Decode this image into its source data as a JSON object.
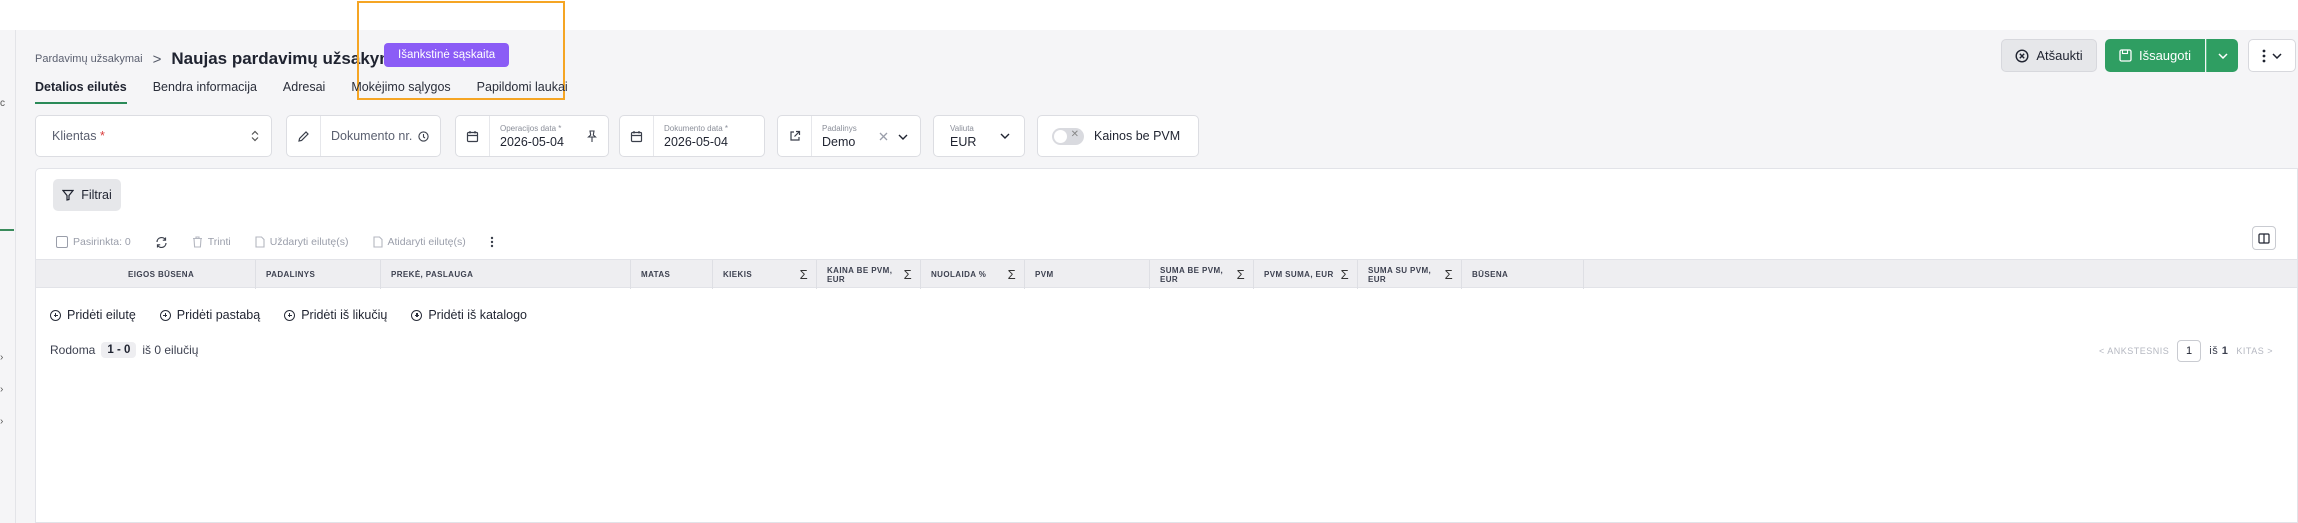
{
  "header": {
    "breadcrumb_parent": "Pardavimų užsakymai",
    "breadcrumb_sep": ">",
    "title": "Naujas pardavimų užsakymas",
    "badge": "Išankstinė sąskaita"
  },
  "tabs": [
    "Detalios eilutės",
    "Bendra informacija",
    "Adresai",
    "Mokėjimo sąlygos",
    "Papildomi laukai"
  ],
  "actions": {
    "cancel_label": "Atšaukti",
    "save_label": "Išsaugoti"
  },
  "fields": {
    "client_label": "Klientas",
    "client_required": "*",
    "doc_number_placeholder": "Dokumento nr.",
    "operation_date_label": "Operacijos data *",
    "operation_date_value": "2026-05-04",
    "document_date_label": "Dokumento data *",
    "document_date_value": "2026-05-04",
    "unit_label": "Padalinys",
    "unit_value": "Demo",
    "currency_label": "Valiuta",
    "currency_value": "EUR",
    "prices_without_vat": "Kainos be PVM"
  },
  "panel": {
    "filters_label": "Filtrai",
    "selected": "Pasirinkta: 0",
    "delete": "Trinti",
    "close_rows": "Uždaryti eilutę(s)",
    "open_rows": "Atidaryti eilutę(s)"
  },
  "table": {
    "columns": [
      {
        "label": "EIGOS BŪSENA",
        "sum": false
      },
      {
        "label": "PADALINYS",
        "sum": false
      },
      {
        "label": "PREKĖ, PASLAUGA",
        "sum": false
      },
      {
        "label": "MATAS",
        "sum": false
      },
      {
        "label": "KIEKIS",
        "sum": true
      },
      {
        "label": "KAINA BE PVM, EUR",
        "sum": true
      },
      {
        "label": "NUOLAIDA %",
        "sum": true
      },
      {
        "label": "PVM",
        "sum": false
      },
      {
        "label": "SUMA BE PVM, EUR",
        "sum": true
      },
      {
        "label": "PVM SUMA, EUR",
        "sum": true
      },
      {
        "label": "SUMA SU PVM, EUR",
        "sum": true
      },
      {
        "label": "BŪSENA",
        "sum": false
      }
    ],
    "sum_symbol": "Σ",
    "rows": []
  },
  "add_actions": [
    "Pridėti eilutę",
    "Pridėti pastabą",
    "Pridėti iš likučių",
    "Pridėti iš katalogo"
  ],
  "pagination": {
    "showing": "Rodoma",
    "range": "1 - 0",
    "of_rows": "iš 0 eilučių",
    "prev": "< ANKSTESNIS",
    "page": "1",
    "of": "iš",
    "total_pages": "1",
    "next": "KITAS >"
  }
}
